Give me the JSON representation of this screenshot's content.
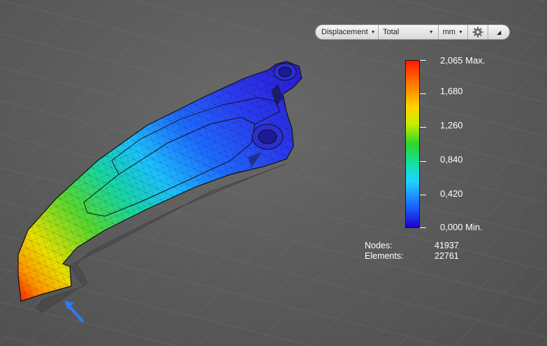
{
  "toolbar": {
    "result_type": "Displacement",
    "component": "Total",
    "units": "mm",
    "settings_icon": "gear-icon",
    "collapse_icon": "triangle-up-icon"
  },
  "legend": {
    "ticks": [
      "2,065 Max.",
      "1,680",
      "1,260",
      "0,840",
      "0,420",
      "0,000 Min."
    ],
    "colors": [
      "#ff1a00",
      "#ffd600",
      "#2bd62b",
      "#1fd4ff",
      "#1a00d4"
    ]
  },
  "stats": {
    "nodes_label": "Nodes:",
    "nodes_value": "41937",
    "elements_label": "Elements:",
    "elements_value": "22761"
  },
  "scene": {
    "load_arrow_color": "#2a7aff"
  }
}
